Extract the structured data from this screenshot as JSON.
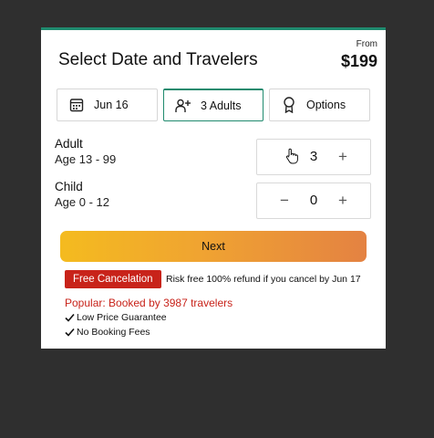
{
  "header": {
    "title": "Select Date and Travelers",
    "from_label": "From",
    "price": "$199"
  },
  "tabs": [
    {
      "label": "Jun 16",
      "icon": "calendar-icon"
    },
    {
      "label": "3 Adults",
      "icon": "add-person-icon"
    },
    {
      "label": "Options",
      "icon": "ribbon-icon"
    }
  ],
  "travelers": [
    {
      "label": "Adult",
      "age": "Age 13 - 99",
      "count": "3",
      "minus": "−",
      "plus": "+"
    },
    {
      "label": "Child",
      "age": "Age 0 - 12",
      "count": "0",
      "minus": "−",
      "plus": "+"
    }
  ],
  "next_label": "Next",
  "cancellation": {
    "badge": "Free Cancelation",
    "text": "Risk free 100% refund if you cancel by Jun 17"
  },
  "popular": "Popular: Booked by 3987 travelers",
  "features": [
    "Low Price Guarantee",
    "No Booking Fees"
  ],
  "colors": {
    "accent": "#1f8a6e",
    "alert": "#c8231a",
    "button_start": "#f4bb1f",
    "button_end": "#e48242",
    "backdrop": "#2f2f2f"
  }
}
